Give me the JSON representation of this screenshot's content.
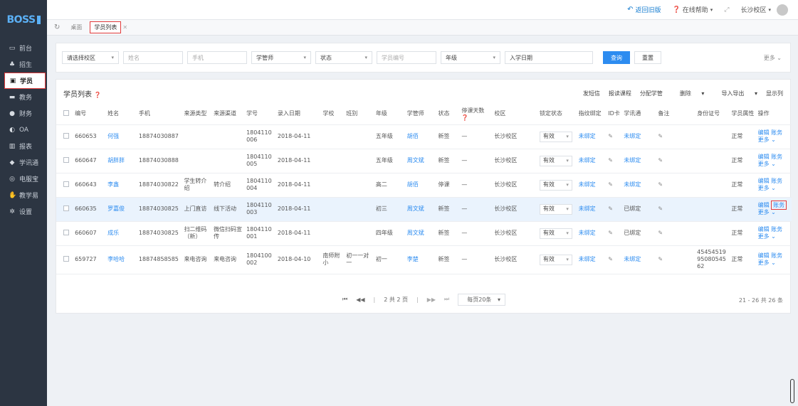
{
  "app": {
    "logo": "BOSS"
  },
  "topbar": {
    "back": "返回旧版",
    "help": "在线帮助",
    "campus": "长沙校区"
  },
  "tabs": [
    {
      "label": "桌面"
    },
    {
      "label": "学员列表"
    }
  ],
  "sidebar": {
    "items": [
      {
        "label": "前台",
        "icon": "calendar-icon"
      },
      {
        "label": "招生",
        "icon": "user-group-icon"
      },
      {
        "label": "学员",
        "icon": "student-card-icon"
      },
      {
        "label": "教务",
        "icon": "monitor-icon"
      },
      {
        "label": "财务",
        "icon": "coin-icon"
      },
      {
        "label": "OA",
        "icon": "toggle-icon"
      },
      {
        "label": "报表",
        "icon": "bar-chart-icon"
      },
      {
        "label": "学讯通",
        "icon": "location-icon"
      },
      {
        "label": "电服宝",
        "icon": "headset-icon"
      },
      {
        "label": "教学易",
        "icon": "hand-icon"
      },
      {
        "label": "设置",
        "icon": "gear-icon"
      }
    ]
  },
  "filters": {
    "campus": "请选择校区",
    "name": "姓名",
    "phone": "手机",
    "manager": "学管师",
    "status": "状态",
    "student_no": "学员编号",
    "grade": "年级",
    "enroll_date": "入学日期",
    "search": "查询",
    "reset": "重置",
    "more": "更多"
  },
  "panel": {
    "title": "学员列表",
    "actions": [
      "发短信",
      "报读课程",
      "分配学管",
      "删除",
      "导入导出",
      "显示列"
    ]
  },
  "table": {
    "headers": [
      "编号",
      "姓名",
      "手机",
      "来源类型",
      "来源渠道",
      "学号",
      "录入日期",
      "学校",
      "班别",
      "年级",
      "学管师",
      "状态",
      "停课天数",
      "校区",
      "锁定状态",
      "指纹绑定",
      "ID卡",
      "学讯通",
      "备注",
      "身份证号",
      "学员属性",
      "操作"
    ],
    "rows": [
      {
        "id": "660653",
        "name": "何强",
        "phone": "18874030887",
        "src_type": "",
        "src_channel": "",
        "sno": "1804110006",
        "date": "2018-04-11",
        "school": "",
        "cls": "",
        "grade": "五年级",
        "mgr": "胡佰",
        "status": "新签",
        "days": "—",
        "campus": "长沙校区",
        "lock": "有效",
        "fp": "未绑定",
        "xxt": "未绑定",
        "idno": "",
        "attr": "正常",
        "edit": "编辑",
        "account": "账务",
        "more": "更多"
      },
      {
        "id": "660647",
        "name": "胡胖胖",
        "phone": "18874030888",
        "src_type": "",
        "src_channel": "",
        "sno": "1804110005",
        "date": "2018-04-11",
        "school": "",
        "cls": "",
        "grade": "五年级",
        "mgr": "周文斌",
        "status": "新签",
        "days": "—",
        "campus": "长沙校区",
        "lock": "有效",
        "fp": "未绑定",
        "xxt": "未绑定",
        "idno": "",
        "attr": "正常",
        "edit": "编辑",
        "account": "账务",
        "more": "更多"
      },
      {
        "id": "660643",
        "name": "李鑫",
        "phone": "18874030822",
        "src_type": "学生转介绍",
        "src_channel": "转介绍",
        "sno": "1804110004",
        "date": "2018-04-11",
        "school": "",
        "cls": "",
        "grade": "高二",
        "mgr": "胡佰",
        "status": "停课",
        "days": "—",
        "campus": "长沙校区",
        "lock": "有效",
        "fp": "未绑定",
        "xxt": "未绑定",
        "idno": "",
        "attr": "正常",
        "edit": "编辑",
        "account": "账务",
        "more": "更多"
      },
      {
        "id": "660635",
        "name": "罗嘉俊",
        "phone": "18874030825",
        "src_type": "上门直访",
        "src_channel": "线下活动",
        "sno": "1804110003",
        "date": "2018-04-11",
        "school": "",
        "cls": "",
        "grade": "初三",
        "mgr": "周文斌",
        "status": "新签",
        "days": "—",
        "campus": "长沙校区",
        "lock": "有效",
        "fp": "未绑定",
        "xxt": "已绑定",
        "idno": "",
        "attr": "正常",
        "edit": "编辑",
        "account": "账务",
        "more": "更多"
      },
      {
        "id": "660607",
        "name": "成乐",
        "phone": "18874030825",
        "src_type": "扫二维码（新）",
        "src_channel": "微信扫码宣传",
        "sno": "1804110001",
        "date": "2018-04-11",
        "school": "",
        "cls": "",
        "grade": "四年级",
        "mgr": "周文斌",
        "status": "新签",
        "days": "—",
        "campus": "长沙校区",
        "lock": "有效",
        "fp": "未绑定",
        "xxt": "已绑定",
        "idno": "",
        "attr": "正常",
        "edit": "编辑",
        "account": "账务",
        "more": "更多"
      },
      {
        "id": "659727",
        "name": "李哈哈",
        "phone": "18874858585",
        "src_type": "来电咨询",
        "src_channel": "来电咨询",
        "sno": "1804100002",
        "date": "2018-04-10",
        "school": "南师附小",
        "cls": "初一一对一",
        "grade": "初一",
        "mgr": "李楚",
        "status": "新签",
        "days": "—",
        "campus": "长沙校区",
        "lock": "有效",
        "fp": "未绑定",
        "xxt": "未绑定",
        "idno": "454545199508054562",
        "attr": "正常",
        "edit": "编辑",
        "account": "账务",
        "more": "更多"
      }
    ]
  },
  "pager": {
    "page_info": "2 共 2 页",
    "per_page": "每页20条",
    "range": "21 - 26 共 26 条"
  }
}
